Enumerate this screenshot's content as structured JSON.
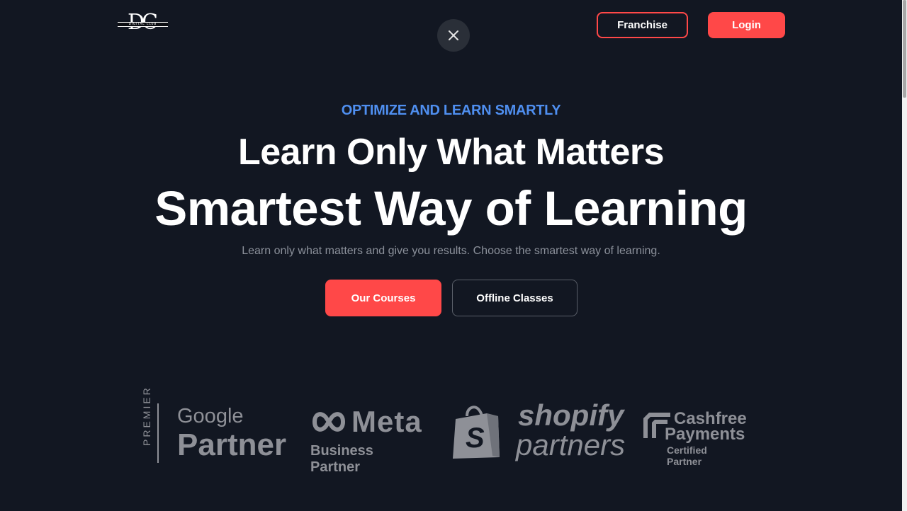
{
  "header": {
    "logo_letters": "DC",
    "logo_sub": "DIGITAL CLUB",
    "franchise_label": "Franchise",
    "login_label": "Login"
  },
  "hero": {
    "eyebrow": "OPTIMIZE AND LEARN SMARTLY",
    "title_line1": "Learn Only What Matters",
    "title_line2": "Smartest Way of Learning",
    "subtitle": "Learn only what matters and give you results. Choose the smartest way of learning.",
    "courses_label": "Our Courses",
    "offline_label": "Offline Classes"
  },
  "partners": {
    "google": {
      "premier": "PREMIER",
      "name": "Google",
      "label": "Partner"
    },
    "meta": {
      "name": "Meta",
      "label": "Business Partner"
    },
    "shopify": {
      "name": "shopify",
      "label": "partners"
    },
    "cashfree": {
      "name_line1": "Cashfree",
      "name_line2": "Payments",
      "label": "Certified Partner"
    }
  },
  "colors": {
    "background": "#121722",
    "accent": "#ff4848",
    "eyebrow": "#4f8ff0",
    "partner_logo": "#8e9097"
  },
  "icons": {
    "close": "close-icon",
    "meta": "meta-infinity-icon",
    "shopify": "shopify-bag-icon",
    "cashfree": "cashfree-icon"
  }
}
